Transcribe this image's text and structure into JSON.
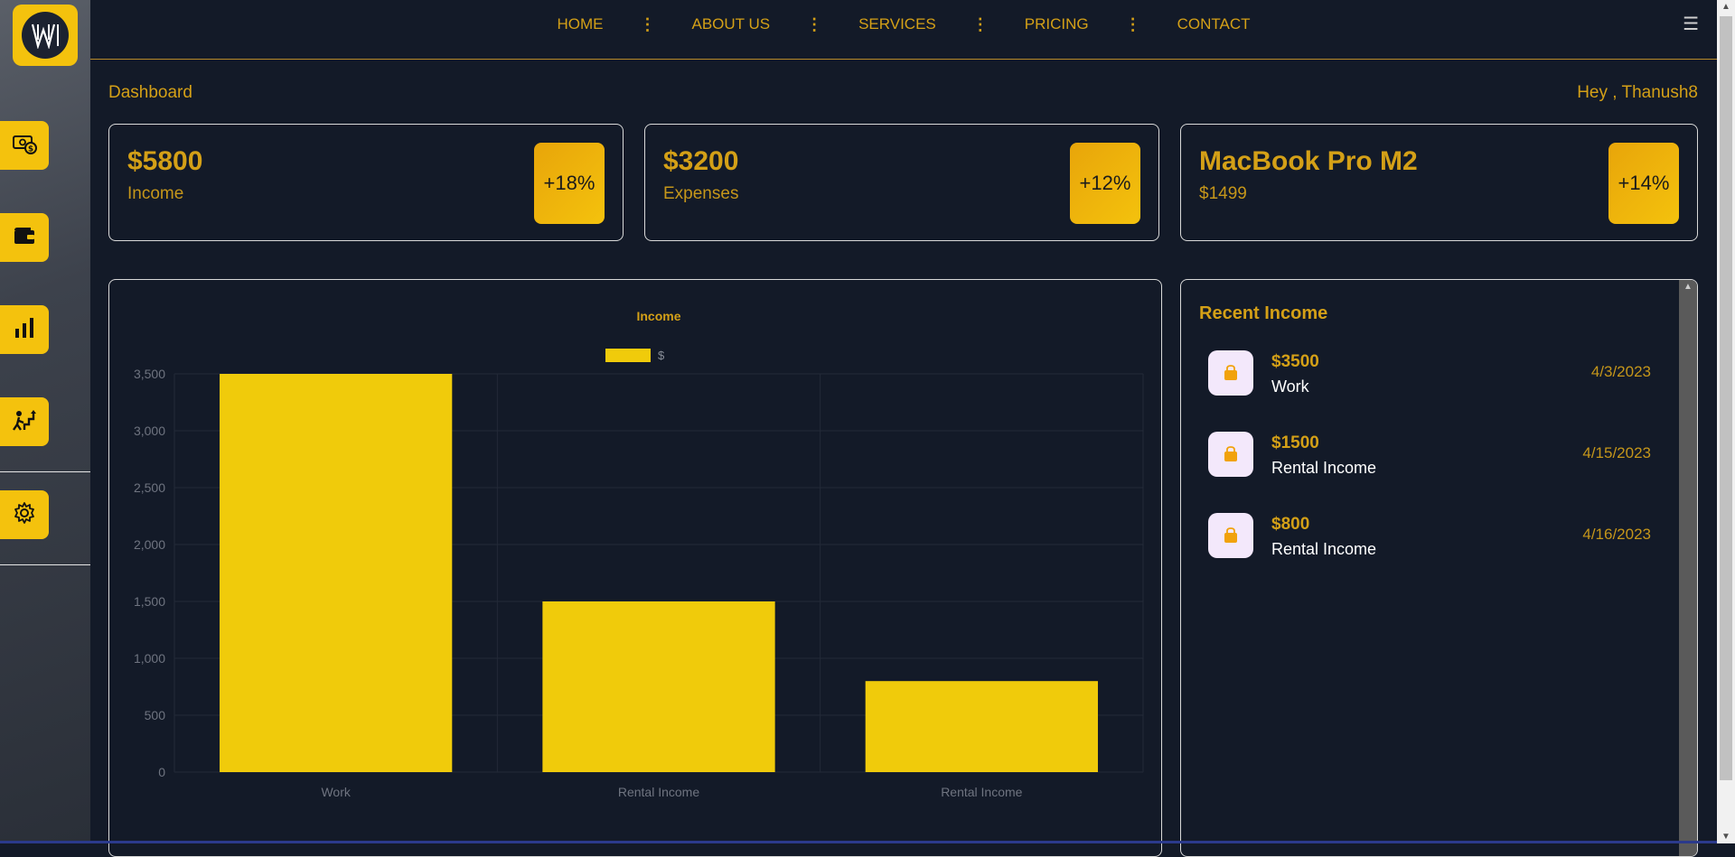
{
  "nav": {
    "items": [
      "HOME",
      "ABOUT US",
      "SERVICES",
      "PRICING",
      "CONTACT"
    ],
    "separator": "⋮",
    "menu_icon": "☰"
  },
  "sidebar": {
    "items": [
      {
        "icon": "money-icon"
      },
      {
        "icon": "wallet-icon"
      },
      {
        "icon": "bar-chart-icon"
      },
      {
        "icon": "growth-icon"
      },
      {
        "icon": "settings-icon"
      }
    ]
  },
  "header": {
    "breadcrumb": "Dashboard",
    "greeting": "Hey , Thanush8"
  },
  "cards": [
    {
      "value": "$5800",
      "label": "Income",
      "badge": "+18%"
    },
    {
      "value": "$3200",
      "label": "Expenses",
      "badge": "+12%"
    },
    {
      "value": "MacBook Pro M2",
      "label": "$1499",
      "badge": "+14%"
    }
  ],
  "chart_data": {
    "type": "bar",
    "title": "Income",
    "categories": [
      "Work",
      "Rental Income",
      "Rental Income"
    ],
    "series": [
      {
        "name": "$",
        "values": [
          3500,
          1500,
          800
        ],
        "color": "#f0cb0b"
      }
    ],
    "ylim": [
      0,
      3500
    ],
    "yticks": [
      0,
      500,
      1000,
      1500,
      2000,
      2500,
      3000,
      3500
    ],
    "ytick_labels": [
      "0",
      "500",
      "1,000",
      "1,500",
      "2,000",
      "2,500",
      "3,000",
      "3,500"
    ],
    "grid": true,
    "legend": "top"
  },
  "recent": {
    "title": "Recent Income",
    "items": [
      {
        "amount": "$3500",
        "name": "Work",
        "date": "4/3/2023"
      },
      {
        "amount": "$1500",
        "name": "Rental Income",
        "date": "4/15/2023"
      },
      {
        "amount": "$800",
        "name": "Rental Income",
        "date": "4/16/2023"
      }
    ]
  },
  "colors": {
    "background": "#131a28",
    "accent": "#d4a017",
    "yellow": "#f4c20d",
    "bar": "#f0cb0b"
  }
}
